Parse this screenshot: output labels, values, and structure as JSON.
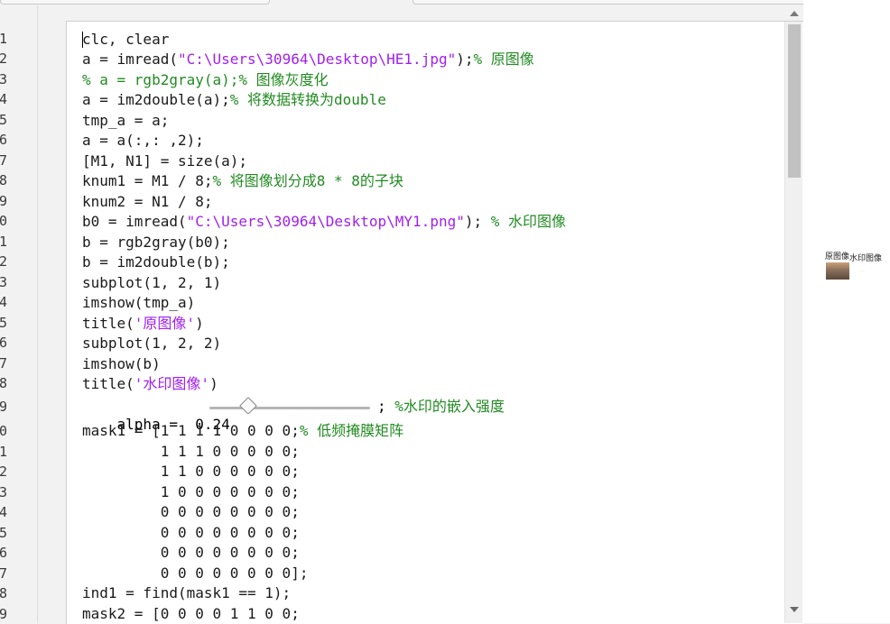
{
  "line_numbers": [
    "1",
    "2",
    "3",
    "4",
    "5",
    "6",
    "7",
    "8",
    "9",
    "0",
    "1",
    "2",
    "3",
    "4",
    "5",
    "6",
    "7",
    "8",
    "9",
    "0",
    "1",
    "2",
    "3",
    "4",
    "5",
    "6",
    "7",
    "8",
    "9"
  ],
  "code": {
    "l1": "clc, clear",
    "l2_a": "a = imread(",
    "l2_str": "\"C:\\Users\\30964\\Desktop\\HE1.jpg\"",
    "l2_b": ");",
    "l2_cmt": "% 原图像",
    "l3": "% a = rgb2gray(a);% 图像灰度化",
    "l4_a": "a = im2double(a);",
    "l4_cmt": "% 将数据转换为double",
    "l5": "tmp_a = a;",
    "l6": "a = a(:,: ,2);",
    "l7": "[M1, N1] = size(a);",
    "l8_a": "knum1 = M1 / 8;",
    "l8_cmt": "% 将图像划分成8 * 8的子块",
    "l9": "knum2 = N1 / 8;",
    "l10_a": "b0 = imread(",
    "l10_str": "\"C:\\Users\\30964\\Desktop\\MY1.png\"",
    "l10_b": "); ",
    "l10_cmt": "% 水印图像",
    "l11": "b = rgb2gray(b0);",
    "l12": "b = im2double(b);",
    "l13": "subplot(1, 2, 1)",
    "l14": "imshow(tmp_a)",
    "l15_a": "title(",
    "l15_str": "'原图像'",
    "l15_b": ")",
    "l16": "subplot(1, 2, 2)",
    "l17": "imshow(b)",
    "l18_a": "title(",
    "l18_str": "'水印图像'",
    "l18_b": ")",
    "l19_a": "alpha =  0.24",
    "l19_b": "; ",
    "l19_cmt": "%水印的嵌入强度",
    "l20_a": "mask1 = [1 1 1 1 0 0 0 0;",
    "l20_cmt": "% 低频掩膜矩阵",
    "l21": "         1 1 1 0 0 0 0 0;",
    "l22": "         1 1 0 0 0 0 0 0;",
    "l23": "         1 0 0 0 0 0 0 0;",
    "l24": "         0 0 0 0 0 0 0 0;",
    "l25": "         0 0 0 0 0 0 0 0;",
    "l26": "         0 0 0 0 0 0 0 0;",
    "l27": "         0 0 0 0 0 0 0 0];",
    "l28": "ind1 = find(mask1 == 1);",
    "l29": "mask2 = [0 0 0 0 1 1 0 0;"
  },
  "alpha_slider": {
    "value": 0.24,
    "fraction": 0.2
  },
  "figure": {
    "title_left": "原图像",
    "title_right": "水印图像"
  },
  "colors": {
    "comment": "#228b22",
    "string": "#a020f0",
    "text": "#1a1a1a"
  }
}
